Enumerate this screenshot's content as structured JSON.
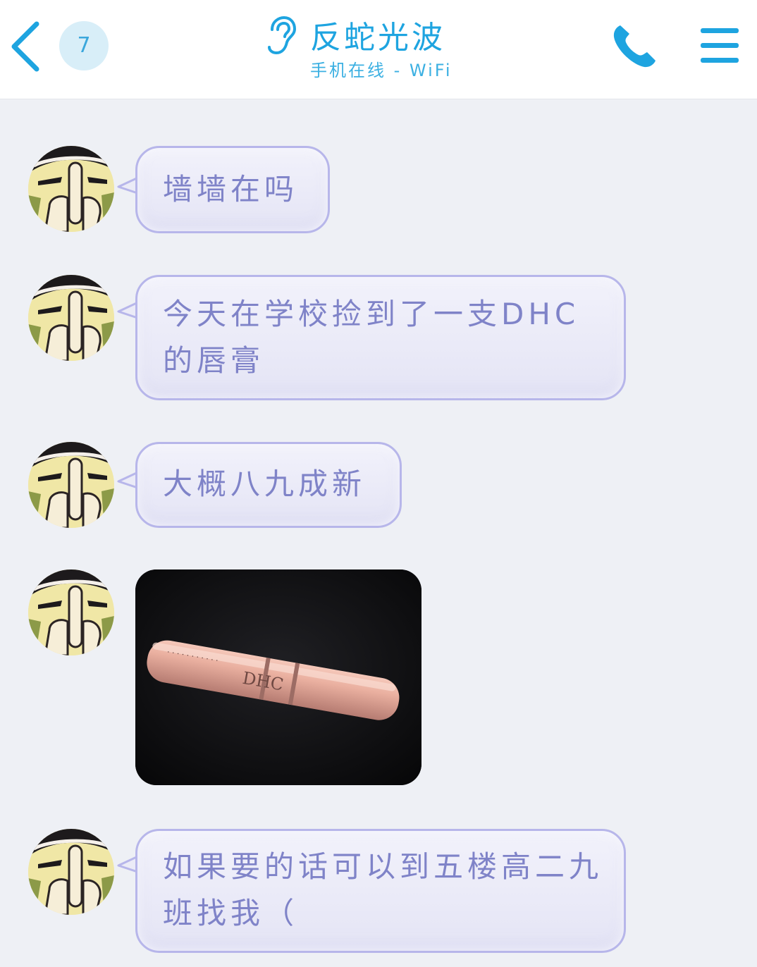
{
  "header": {
    "unread_count": "7",
    "title": "反蛇光波",
    "subtitle": "手机在线 - WiFi",
    "icons": {
      "back": "back-chevron-icon",
      "ear": "ear-icon",
      "phone": "phone-icon",
      "menu": "menu-icon"
    }
  },
  "messages": [
    {
      "type": "text",
      "text": "墙墙在吗"
    },
    {
      "type": "text",
      "text": "今天在学校捡到了一支DHC的唇膏"
    },
    {
      "type": "text",
      "text": "大概八九成新"
    },
    {
      "type": "image",
      "text": "DHC"
    },
    {
      "type": "text",
      "text": "如果要的话可以到五楼高二九班找我（"
    }
  ],
  "colors": {
    "accent": "#1ea4e0",
    "bubble_text": "#7f83c8",
    "bubble_border": "#b7b6ea",
    "background": "#eef0f5"
  }
}
